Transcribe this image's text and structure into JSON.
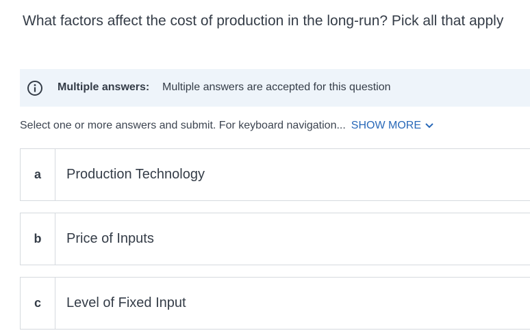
{
  "question": "What factors affect the cost of production in the long-run? Pick all that apply",
  "info": {
    "icon": "info-icon",
    "title": "Multiple answers:",
    "text": "Multiple answers are accepted for this question"
  },
  "instructions": {
    "text": "Select one or more answers and submit. For keyboard navigation...",
    "show_more": "SHOW MORE",
    "show_more_icon": "chevron-down-icon"
  },
  "options": [
    {
      "letter": "a",
      "label": "Production Technology"
    },
    {
      "letter": "b",
      "label": "Price of Inputs"
    },
    {
      "letter": "c",
      "label": "Level of Fixed Input"
    }
  ],
  "colors": {
    "accent": "#2868b8",
    "banner_bg": "#eef4fa",
    "border": "#d5d9de",
    "text": "#343c47"
  }
}
